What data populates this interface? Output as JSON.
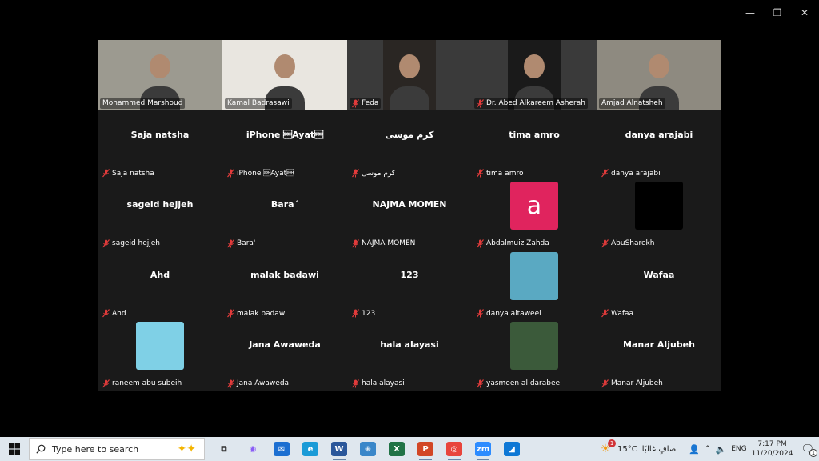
{
  "window": {
    "controls": [
      "—",
      "❐",
      "✕"
    ]
  },
  "tiles": [
    {
      "name": "Mohammed Marshoud",
      "video": true,
      "active": true,
      "muted": false,
      "bg": "#9c9a90"
    },
    {
      "name": "Kamal Badrasawi",
      "video": true,
      "muted": false,
      "bg": "#e9e6e0"
    },
    {
      "name": "Feda",
      "video": true,
      "muted": true,
      "bg": "#2a2623",
      "inset": true
    },
    {
      "name": "Dr. Abed Alkareem Asherah",
      "video": true,
      "muted": true,
      "bg": "#1a1a1a",
      "inset": true
    },
    {
      "name": "Amjad Alnatsheh",
      "video": true,
      "muted": false,
      "bg": "#8e8a80"
    },
    {
      "name": "Saja natsha",
      "display": "Saja natsha",
      "muted": true
    },
    {
      "name": "iPhone \u0001Ayat\u0001",
      "display": "iPhone \u0001Ayat\u0001",
      "muted": true
    },
    {
      "name": "كرم موسى",
      "display": "كرم موسى",
      "muted": true
    },
    {
      "name": "tima amro",
      "display": "tima amro",
      "muted": true
    },
    {
      "name": "danya arajabi",
      "display": "danya arajabi",
      "muted": true
    },
    {
      "name": "sageid hejjeh",
      "display": "sageid hejjeh",
      "muted": true
    },
    {
      "name": "Bara'",
      "display": "Bara´",
      "muted": true
    },
    {
      "name": "NAJMA MOMEN",
      "display": "NAJMA MOMEN",
      "muted": true
    },
    {
      "name": "Abdalmuiz Zahda",
      "avatar": "letter",
      "avatar_text": "a",
      "muted": true
    },
    {
      "name": "AbuSharekh",
      "avatar": "black",
      "muted": true
    },
    {
      "name": "Ahd",
      "display": "Ahd",
      "muted": true
    },
    {
      "name": "malak badawi",
      "display": "malak badawi",
      "muted": true
    },
    {
      "name": "123",
      "display": "123",
      "muted": true
    },
    {
      "name": "danya altaweel",
      "avatar": "image",
      "avatar_bg": "#5aa9c2",
      "muted": true
    },
    {
      "name": "Wafaa",
      "display": "Wafaa",
      "muted": true
    },
    {
      "name": "raneem abu subeih",
      "avatar": "image",
      "avatar_bg": "#7fd0e6",
      "muted": true
    },
    {
      "name": "Jana Awaweda",
      "display": "Jana Awaweda",
      "muted": true
    },
    {
      "name": "hala alayasi",
      "display": "hala alayasi",
      "muted": true
    },
    {
      "name": "yasmeen al darabee",
      "avatar": "image",
      "avatar_bg": "#3b5a3a",
      "muted": true
    },
    {
      "name": "Manar Aljubeh",
      "display": "Manar Aljubeh",
      "muted": true
    }
  ],
  "taskbar": {
    "search_placeholder": "Type here to search",
    "apps": [
      {
        "icon": "task-view-icon",
        "label": "⧉",
        "bg": "transparent",
        "fg": "#333"
      },
      {
        "icon": "copilot-icon",
        "label": "◉",
        "bg": "transparent",
        "fg": "#8a5cf6"
      },
      {
        "icon": "mail-icon",
        "label": "✉",
        "bg": "#1c6fd1",
        "fg": "#fff"
      },
      {
        "icon": "edge-icon",
        "label": "e",
        "bg": "#1a9bd7",
        "fg": "#fff"
      },
      {
        "icon": "word-icon",
        "label": "W",
        "bg": "#2b579a",
        "fg": "#fff",
        "open": true
      },
      {
        "icon": "network-app-icon",
        "label": "⊕",
        "bg": "#3a87c9",
        "fg": "#fff"
      },
      {
        "icon": "excel-icon",
        "label": "X",
        "bg": "#217346",
        "fg": "#fff"
      },
      {
        "icon": "powerpoint-icon",
        "label": "P",
        "bg": "#d24726",
        "fg": "#fff",
        "open": true
      },
      {
        "icon": "chrome-icon",
        "label": "◎",
        "bg": "#e8453c",
        "fg": "#fff",
        "open": true
      },
      {
        "icon": "zoom-icon",
        "label": "zm",
        "bg": "#2d8cff",
        "fg": "#fff",
        "open": true
      },
      {
        "icon": "photos-icon",
        "label": "◢",
        "bg": "#0e78d5",
        "fg": "#fff"
      }
    ],
    "weather": "15°C",
    "weather_text": "صافٍ غالبًا",
    "weather_badge": "1",
    "language": "ENG",
    "time": "7:17 PM",
    "date": "11/20/2024",
    "notification_count": "1"
  }
}
